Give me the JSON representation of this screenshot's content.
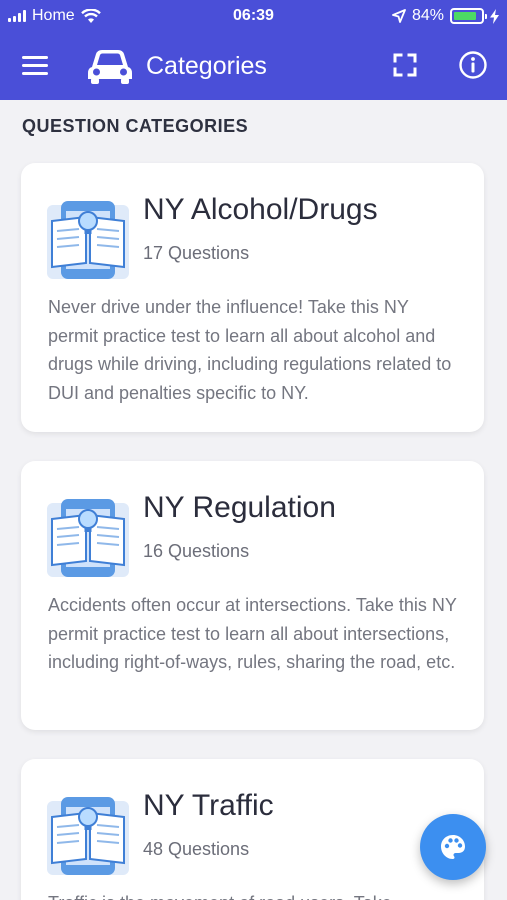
{
  "status_bar": {
    "carrier": "Home",
    "time": "06:39",
    "battery": "84%",
    "battery_level": 0.84
  },
  "toolbar": {
    "title": "Categories",
    "icons": [
      "menu-icon",
      "car-icon",
      "fullscreen-icon",
      "info-icon"
    ]
  },
  "section_header": "QUESTION CATEGORIES",
  "categories": [
    {
      "title": "NY Alcohol/Drugs",
      "count": "17 Questions",
      "description": "Never drive under the influence! Take this NY permit practice test to learn all about alcohol and drugs while driving, including regulations related to DUI and penalties specific to NY."
    },
    {
      "title": "NY Regulation",
      "count": "16 Questions",
      "description": "Accidents often occur at intersections. Take this NY permit practice test to learn all about intersections, including right-of-ways, rules, sharing the road, etc."
    },
    {
      "title": "NY Traffic",
      "count": "48 Questions",
      "description": "Traffic is the movement of road users. Take"
    }
  ],
  "fab": {
    "icon": "palette-icon"
  },
  "colors": {
    "primary": "#4a4fd8",
    "fab": "#3c8ff0",
    "battery_fill": "#4cd964"
  }
}
